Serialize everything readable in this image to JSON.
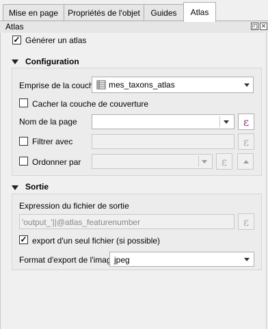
{
  "tabs": [
    {
      "label": "Mise en page"
    },
    {
      "label": "Propriétés de l'objet"
    },
    {
      "label": "Guides"
    },
    {
      "label": "Atlas"
    }
  ],
  "dock": {
    "title": "Atlas"
  },
  "generate_atlas": {
    "label": "Générer un atlas",
    "checked": true
  },
  "configuration": {
    "title": "Configuration",
    "coverage_layer": {
      "label": "Emprise de la couche",
      "value": "mes_taxons_atlas"
    },
    "hide_coverage": {
      "label": "Cacher la couche de couverture",
      "checked": false
    },
    "page_name": {
      "label": "Nom de la page",
      "value": ""
    },
    "filter_with": {
      "label": "Filtrer avec",
      "checked": false,
      "value": ""
    },
    "sort_by": {
      "label": "Ordonner par",
      "checked": false,
      "value": ""
    }
  },
  "output": {
    "title": "Sortie",
    "filename_expr_label": "Expression du fichier de sortie",
    "filename_expr_value": "'output_'||@atlas_featurenumber",
    "single_file": {
      "label": "export d'un seul fichier (si possible)",
      "checked": true
    },
    "image_format": {
      "label": "Format d'export de l'image",
      "value": "jpeg"
    }
  },
  "icons": {
    "expression": "ε",
    "check": "✓",
    "undock": "◰",
    "close": "✕"
  }
}
